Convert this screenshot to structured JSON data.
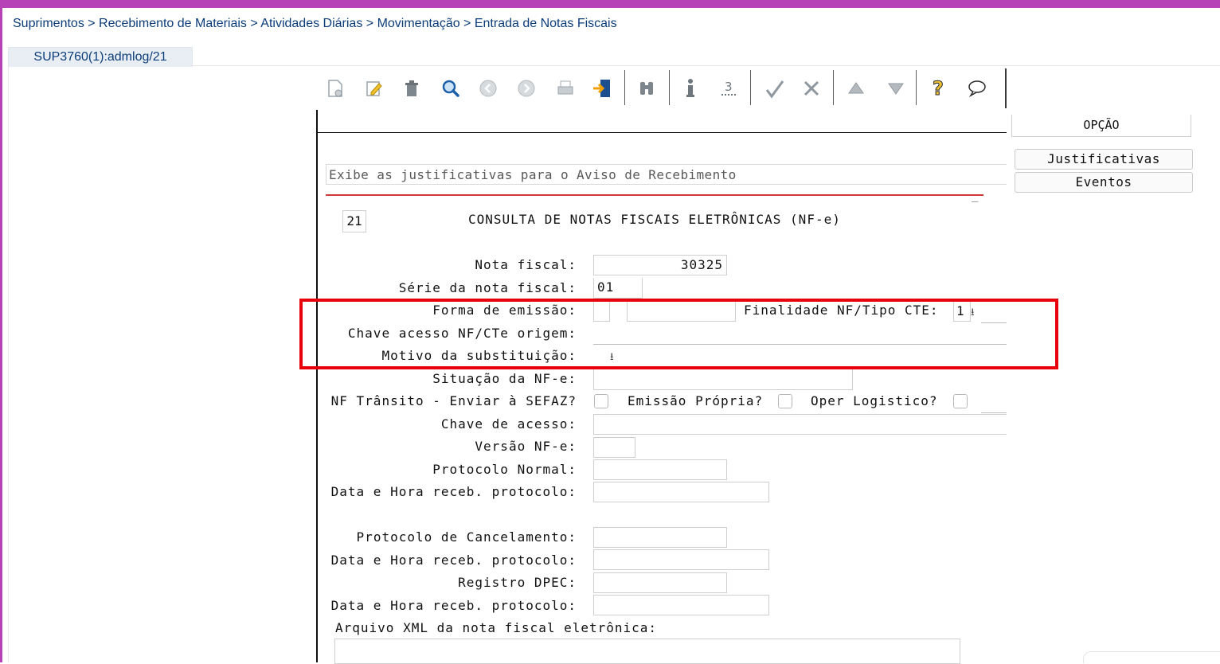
{
  "breadcrumb": "Suprimentos > Recebimento de Materiais > Atividades Diárias > Movimentação > Entrada de Notas Fiscais",
  "tab_label": "SUP3760(1):admlog/21",
  "toolbar": {
    "icons": [
      "new-icon",
      "edit-icon",
      "delete-icon",
      "find-icon",
      "previous-icon",
      "next-icon",
      "print-icon",
      "exit-icon",
      "binoculars-icon",
      "info-icon",
      "zoom-icon",
      "confirm-icon",
      "cancel-icon",
      "up-icon",
      "down-icon",
      "help-icon",
      "chat-icon"
    ]
  },
  "message": "Exibe as justificativas para o Aviso de Recebimento",
  "side": {
    "option_header": "OPÇÃO",
    "buttons": [
      "Justificativas",
      "Eventos"
    ]
  },
  "screen": {
    "number": "21",
    "title": "CONSULTA DE NOTAS FISCAIS ELETRÔNICAS (NF-e)"
  },
  "form": {
    "nota_fiscal_label": "Nota fiscal:",
    "nota_fiscal_value": "30325",
    "serie_label": "Série da nota fiscal:",
    "serie_value": "01",
    "forma_emissao_label": "Forma de emissão:",
    "finalidade_label": "Finalidade NF/Tipo CTE:",
    "finalidade_value": "1",
    "chave_origem_label": "Chave acesso NF/CTe origem:",
    "motivo_label": "Motivo da substituição:",
    "situacao_label": "Situação da NF-e:",
    "transito_label": "NF Trânsito - Enviar à SEFAZ?",
    "emissao_propria_label": "Emissão Própria?",
    "oper_logistico_label": "Oper Logistico?",
    "chave_acesso_label": "Chave de acesso:",
    "versao_label": "Versão NF-e:",
    "protocolo_normal_label": "Protocolo Normal:",
    "data_hora_1_label": "Data e Hora receb. protocolo:",
    "protocolo_cancel_label": "Protocolo de Cancelamento:",
    "data_hora_2_label": "Data e Hora receb. protocolo:",
    "registro_dpec_label": "Registro DPEC:",
    "data_hora_3_label": "Data e Hora receb. protocolo:",
    "arquivo_xml_label": "Arquivo XML da nota fiscal eletrônica:"
  },
  "highlight_color": "#e8000b",
  "brand_color": "#b742b8"
}
